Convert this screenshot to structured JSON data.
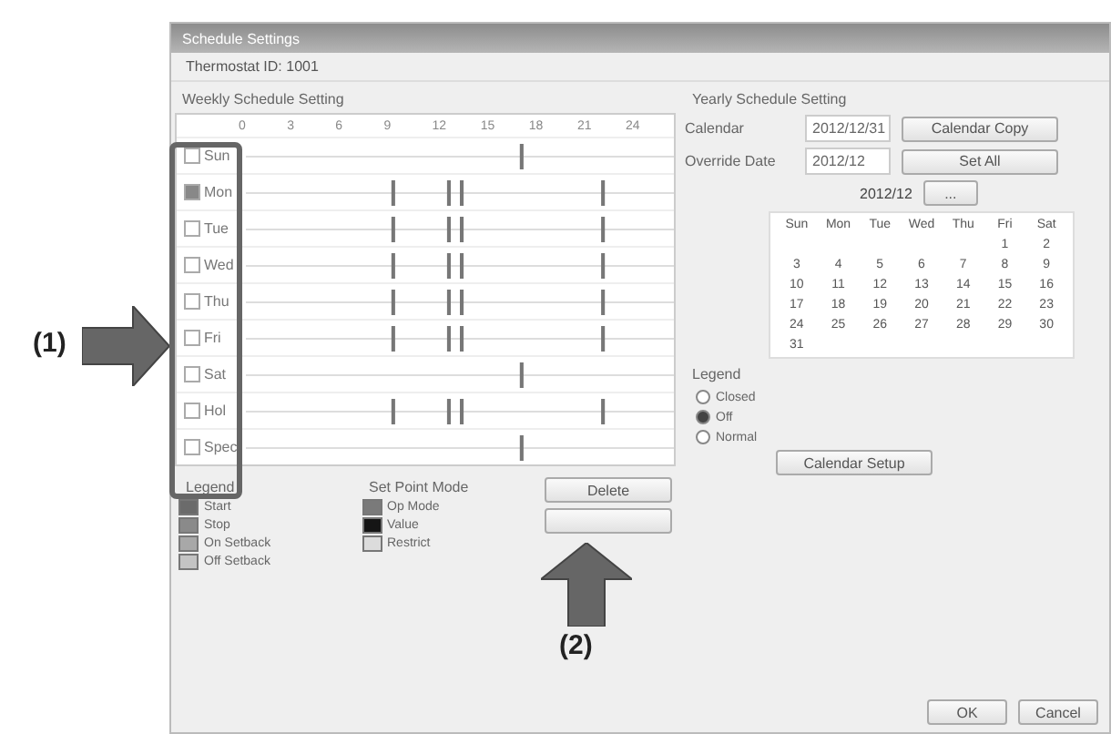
{
  "annotations": [
    {
      "label": "(1)",
      "kind": "right"
    },
    {
      "label": "(2)",
      "kind": "up"
    }
  ],
  "window": {
    "title": "Schedule Settings",
    "subtitle": "Thermostat ID: 1001"
  },
  "weekly": {
    "title": "Weekly Schedule Setting",
    "ticks": [
      "0",
      "3",
      "6",
      "9",
      "12",
      "15",
      "18",
      "21",
      "24"
    ],
    "days": [
      {
        "label": "Sun",
        "kind": "off",
        "checked": false
      },
      {
        "label": "Mon",
        "kind": "work",
        "checked": true
      },
      {
        "label": "Tue",
        "kind": "work",
        "checked": false
      },
      {
        "label": "Wed",
        "kind": "work",
        "checked": false
      },
      {
        "label": "Thu",
        "kind": "work",
        "checked": false
      },
      {
        "label": "Fri",
        "kind": "work",
        "checked": false
      },
      {
        "label": "Sat",
        "kind": "off",
        "checked": false
      },
      {
        "label": "Hol",
        "kind": "work",
        "checked": false
      },
      {
        "label": "Spec",
        "kind": "off",
        "checked": false
      }
    ],
    "legend_title": "Legend",
    "legend": [
      {
        "label": "Start",
        "color": "#6b6b6b"
      },
      {
        "label": "Stop",
        "color": "#8a8a8a"
      },
      {
        "label": "On Setback",
        "color": "#a8a8a8"
      },
      {
        "label": "Off Setback",
        "color": "#c4c4c4"
      }
    ],
    "legend2_title": "Set Point Mode",
    "legend2": [
      {
        "label": "Op Mode",
        "color": "#7a7a7a"
      },
      {
        "label": "Value",
        "color": "#151515"
      },
      {
        "label": "Restrict",
        "color": "#dcdcdc"
      }
    ],
    "buttons": [
      {
        "kind": "text",
        "label": "Delete"
      },
      {
        "kind": "blank"
      }
    ]
  },
  "yearly": {
    "title": "Yearly Schedule Setting",
    "rows": [
      {
        "label": "Calendar",
        "value": "2012/12/31",
        "button": "Calendar Copy"
      },
      {
        "label": "Override Date",
        "value": "2012/12",
        "button": "Set All"
      }
    ],
    "month": "2012/12",
    "month_button": "...",
    "weekdays": [
      "Sun",
      "Mon",
      "Tue",
      "Wed",
      "Thu",
      "Fri",
      "Sat"
    ],
    "weeks": [
      [
        "1",
        "2"
      ],
      [
        "3",
        "4",
        "5",
        "6",
        "7",
        "8",
        "9"
      ],
      [
        "10",
        "11",
        "12",
        "13",
        "14",
        "15",
        "16"
      ],
      [
        "17",
        "18",
        "19",
        "20",
        "21",
        "22",
        "23"
      ],
      [
        "24",
        "25",
        "26",
        "27",
        "28",
        "29",
        "30"
      ],
      [
        "31"
      ]
    ],
    "legend_title": "Legend",
    "legend": [
      {
        "label": "Closed",
        "selected": false
      },
      {
        "label": "Off",
        "selected": true
      },
      {
        "label": "Normal",
        "selected": false
      }
    ],
    "setup_button": "Calendar Setup"
  },
  "footer": [
    "OK",
    "Cancel"
  ]
}
